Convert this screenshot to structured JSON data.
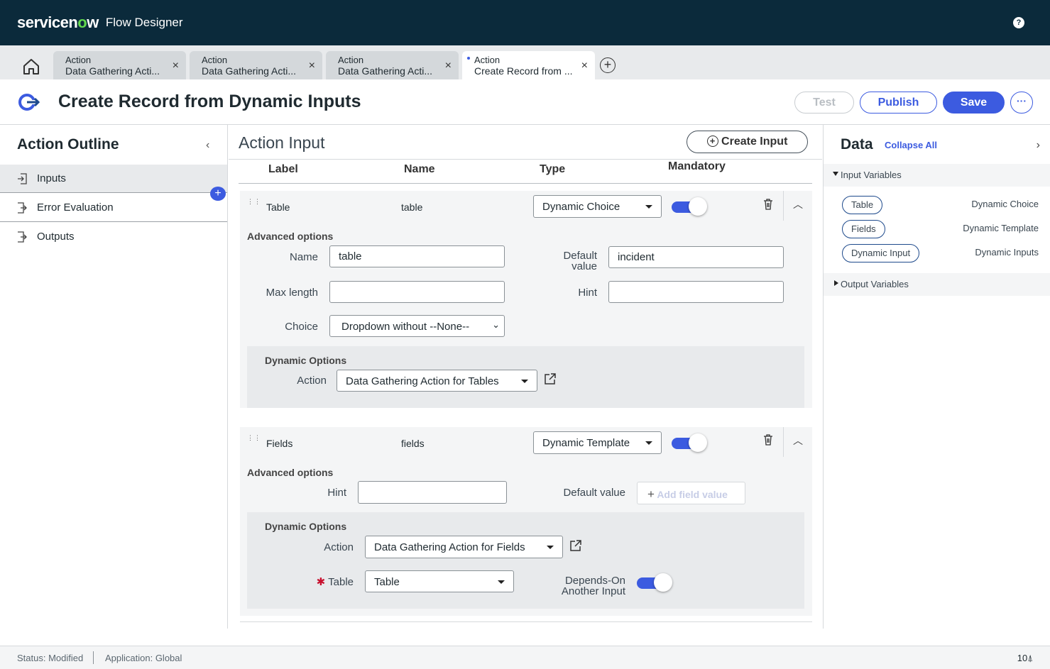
{
  "header": {
    "brand": "servicenow",
    "brand_pre": "servicen",
    "brand_o": "o",
    "brand_post": "w",
    "product": "Flow Designer",
    "help_label": "?"
  },
  "tabs": [
    {
      "type": "Action",
      "name": "Data Gathering Acti...",
      "close": "×"
    },
    {
      "type": "Action",
      "name": "Data Gathering Acti...",
      "close": "×"
    },
    {
      "type": "Action",
      "name": "Data Gathering Acti...",
      "close": "×"
    },
    {
      "type": "Action",
      "name": "Create Record from ...",
      "close": "×"
    }
  ],
  "add_tab": "+",
  "title": {
    "text": "Create Record from Dynamic Inputs",
    "test": "Test",
    "publish": "Publish",
    "save": "Save",
    "more": "···"
  },
  "outline": {
    "title": "Action Outline",
    "collapse": "‹",
    "add": "+",
    "items": [
      "Inputs",
      "Error Evaluation",
      "Outputs"
    ]
  },
  "action_input": {
    "title": "Action Input",
    "create": "Create Input",
    "columns": {
      "label": "Label",
      "name": "Name",
      "type": "Type",
      "mandatory": "Mandatory"
    },
    "advanced": "Advanced options",
    "dynamic_options": "Dynamic Options",
    "rows": [
      {
        "label": "Table",
        "name": "table",
        "type": "Dynamic Choice",
        "mandatory": true,
        "fields": {
          "name_label": "Name",
          "name_value": "table",
          "default_label": "Default value",
          "default_label_1": "Default",
          "default_label_2": "value",
          "default_value": "incident",
          "maxlen_label": "Max length",
          "maxlen_value": "",
          "hint_label": "Hint",
          "hint_value": "",
          "choice_label": "Choice",
          "choice_value": "Dropdown without --None--"
        },
        "dynamic": {
          "action_label": "Action",
          "action_value": "Data Gathering Action for Tables"
        }
      },
      {
        "label": "Fields",
        "name": "fields",
        "type": "Dynamic Template",
        "mandatory": true,
        "fields": {
          "hint_label": "Hint",
          "hint_value": "",
          "default_label": "Default value",
          "add_field": "Add field value"
        },
        "dynamic": {
          "action_label": "Action",
          "action_value": "Data Gathering Action for Fields",
          "table_label": "Table",
          "table_req": "✱",
          "table_value": "Table",
          "depends_label": "Depends-On Another Input",
          "depends_1": "Depends-On",
          "depends_2": "Another Input",
          "depends_on": true
        }
      }
    ]
  },
  "data_panel": {
    "title": "Data",
    "collapse_all": "Collapse All",
    "expand": "›",
    "input_section": "Input Variables",
    "output_section": "Output Variables",
    "variables": [
      {
        "pill": "Table",
        "type": "Dynamic Choice"
      },
      {
        "pill": "Fields",
        "type": "Dynamic Template"
      },
      {
        "pill": "Dynamic Input",
        "type": "Dynamic Inputs"
      }
    ]
  },
  "status": {
    "state": "Status: Modified",
    "application": "Application: Global",
    "count": "10"
  },
  "colors": {
    "accent": "#3c5be0",
    "header_bg": "#0b2a3b",
    "brand_o": "#62d84e"
  }
}
